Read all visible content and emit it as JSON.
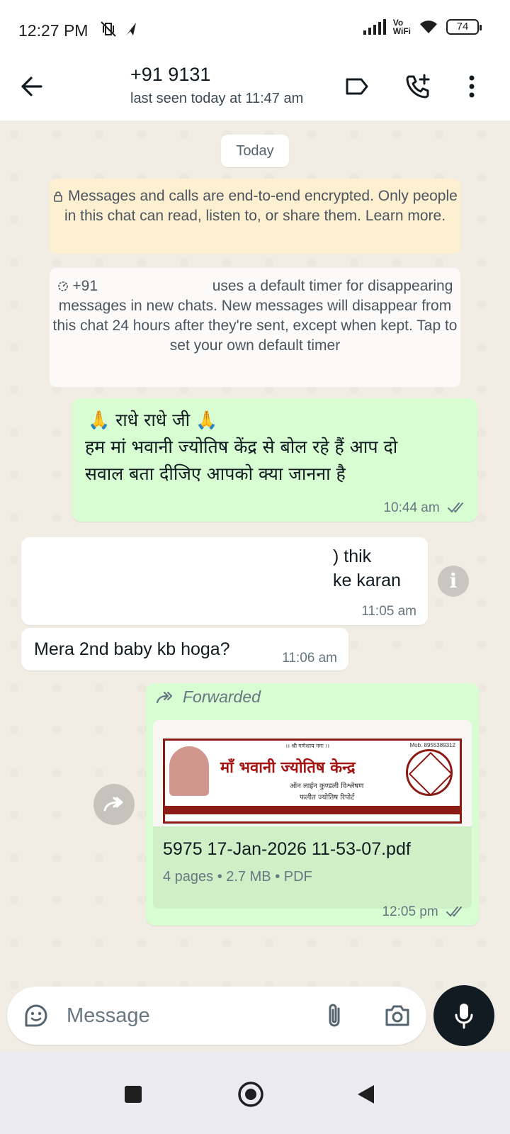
{
  "status_bar": {
    "time": "12:27 PM",
    "network_label": "Vo\nWiFi",
    "battery": "74"
  },
  "header": {
    "contact_name": "+91 9131",
    "last_seen": "last seen today at 11:47 am"
  },
  "chat": {
    "date_chip": "Today",
    "encryption_notice": "Messages and calls are end-to-end encrypted. Only people in this chat can read, listen to, or share them. Learn more.",
    "timer_notice_prefix": "+91",
    "timer_notice_rest": "uses a default timer for disappearing messages in new chats. New messages will disappear from this chat 24 hours after they're sent, except when kept. Tap to set your own default timer",
    "messages": [
      {
        "direction": "out",
        "line1": "🙏 राधे राधे जी 🙏",
        "line2": "हम मां भवानी ज्योतिष केंद्र से बोल रहे हैं आप दो सवाल बता दीजिए आपको क्या जानना है",
        "time": "10:44 am",
        "status": "read"
      },
      {
        "direction": "in",
        "line1_fragment": "thik",
        "line2_fragment": "ke karan",
        "time": "11:05 am"
      },
      {
        "direction": "in",
        "text": "Mera 2nd baby kb hoga?",
        "time": "11:06 am"
      },
      {
        "direction": "out",
        "forwarded_label": "Forwarded",
        "document": {
          "file_name": "5975 17-Jan-2026 11-53-07.pdf",
          "meta": "4 pages • 2.7 MB • PDF",
          "preview_title": "माँ भवानी ज्योतिष केन्द्र",
          "preview_subtitle": "ऑन लाईन कुण्डली विश्लेषण",
          "preview_subtitle2": "फलीत ज्योतिष रिपोर्ट",
          "preview_mobile": "Mob. 8955389312",
          "preview_mantra": "।। श्री गणेशाय नमः ।।"
        },
        "time": "12:05 pm",
        "status": "read"
      }
    ]
  },
  "composer": {
    "placeholder": "Message"
  },
  "colors": {
    "outgoing_bubble": "#d9fdd3",
    "incoming_bubble": "#ffffff",
    "read_ticks": "#667781",
    "notice_yellow": "#fdf0d1"
  }
}
